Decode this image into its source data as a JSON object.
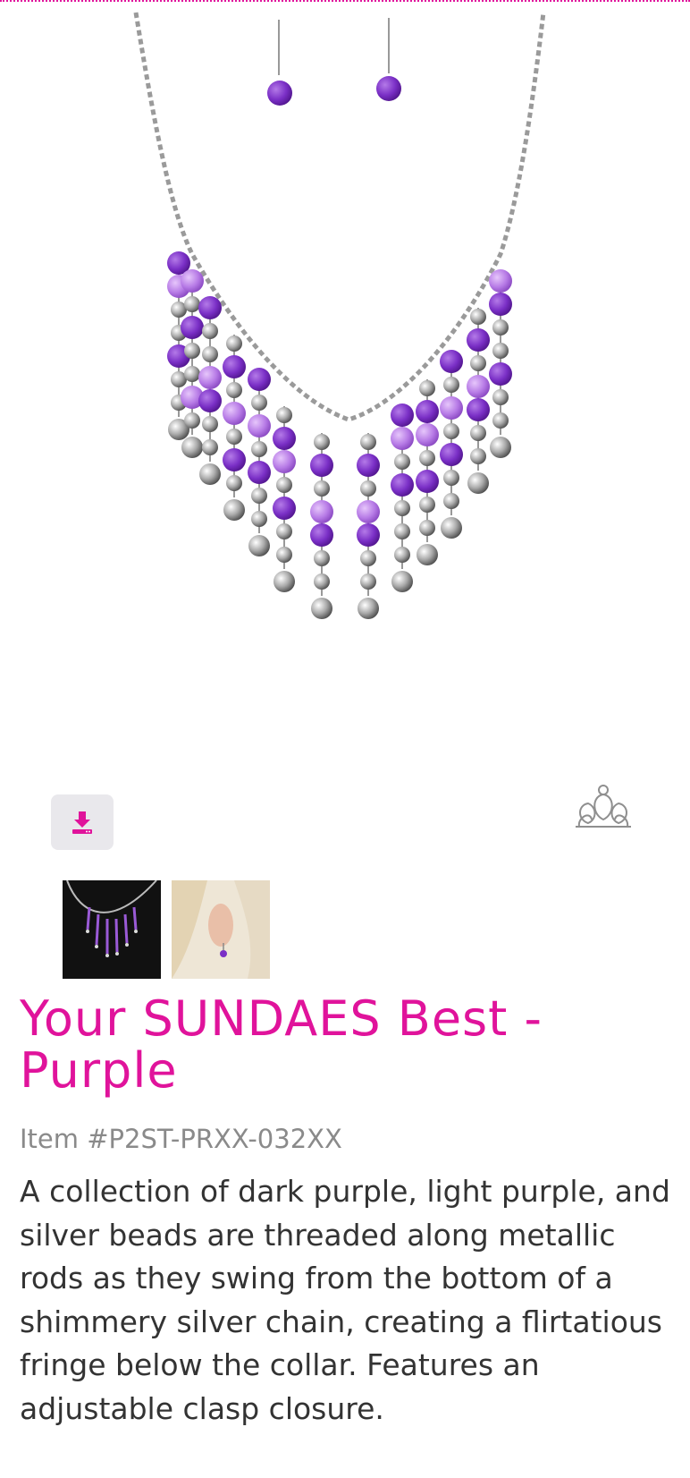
{
  "product": {
    "image_alt": "Your SUNDAES Best - Purple necklace and earrings",
    "title": "Your SUNDAES Best - Purple",
    "item_number": "Item #P2ST-PRXX-032XX",
    "description": "A collection of dark purple, light purple, and silver beads are threaded along metallic rods as they swing from the bottom of a shimmery silver chain, creating a flirtatious fringe below the collar. Features an adjustable clasp closure."
  },
  "icons": {
    "download": "download-icon",
    "brand": "crown-icon"
  },
  "thumbnails": [
    {
      "name": "thumbnail-necklace",
      "alt": "Necklace on black background"
    },
    {
      "name": "thumbnail-earring",
      "alt": "Earring worn"
    }
  ],
  "colors": {
    "accent": "#e0139b",
    "dark_purple": "#7a2fc6",
    "light_purple": "#b77be6",
    "silver": "#b8b8b8"
  }
}
